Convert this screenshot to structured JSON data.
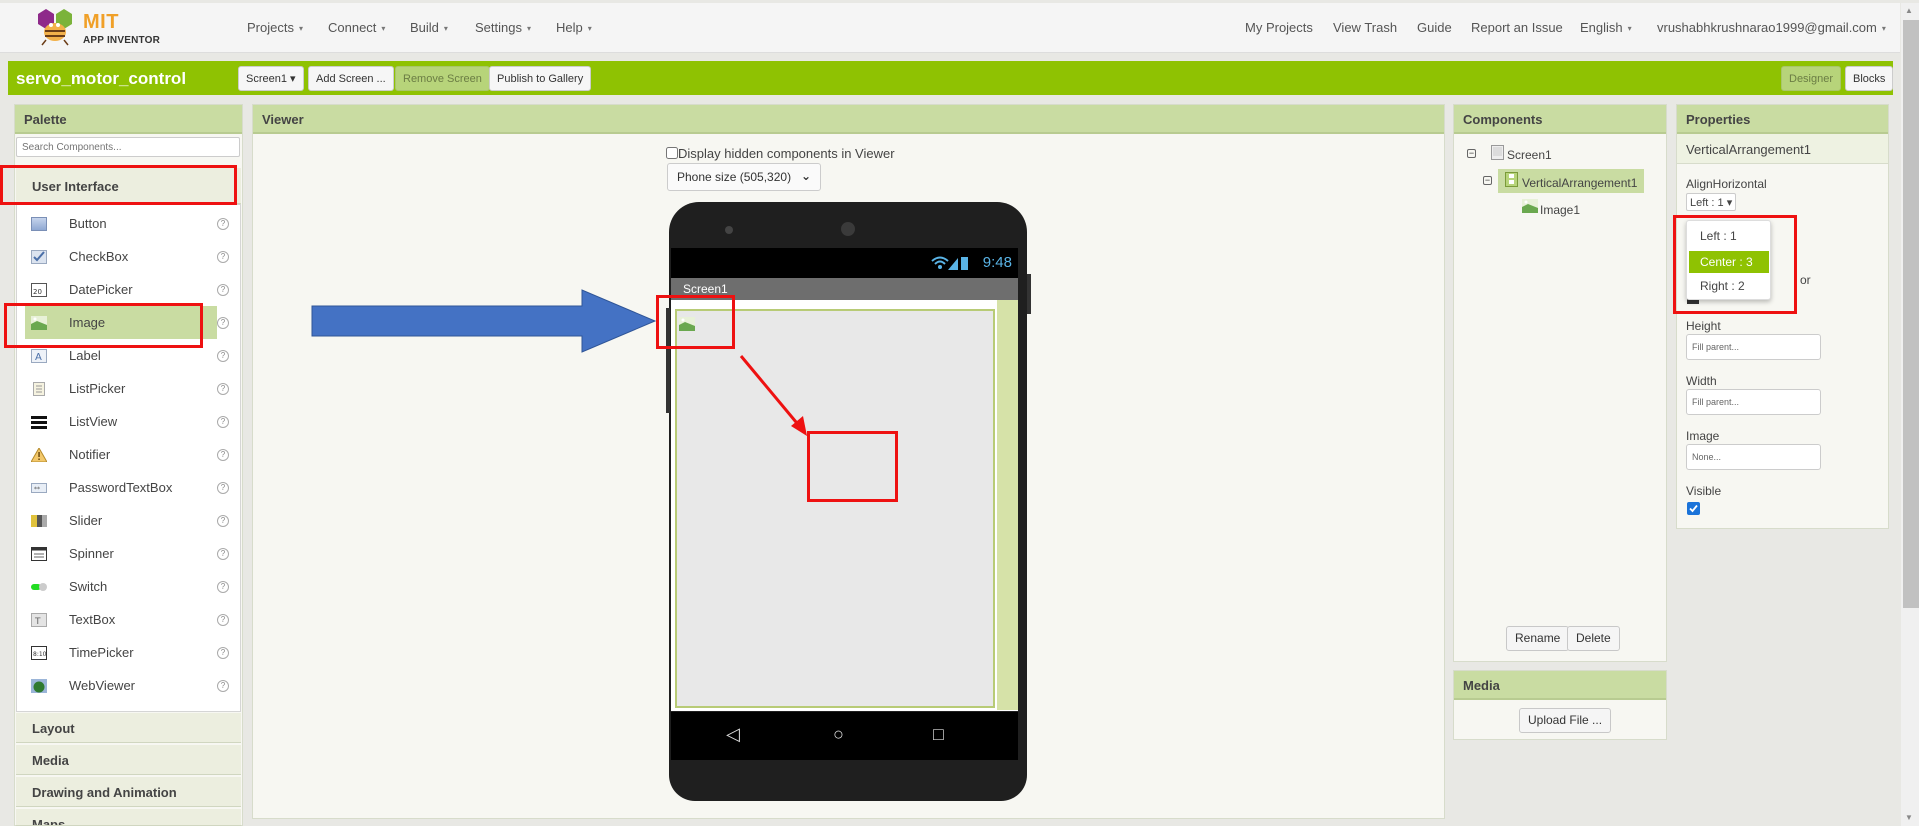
{
  "app": {
    "logo_line1": "MIT",
    "logo_line2": "APP INVENTOR"
  },
  "topnav": {
    "left_menus": [
      {
        "label": "Projects",
        "has_caret": true
      },
      {
        "label": "Connect",
        "has_caret": true
      },
      {
        "label": "Build",
        "has_caret": true
      },
      {
        "label": "Settings",
        "has_caret": true
      },
      {
        "label": "Help",
        "has_caret": true
      }
    ],
    "right_links": [
      {
        "label": "My Projects"
      },
      {
        "label": "View Trash"
      },
      {
        "label": "Guide"
      },
      {
        "label": "Report an Issue"
      },
      {
        "label": "English",
        "has_caret": true
      },
      {
        "label": "vrushabhkrushnarao1999@gmail.com",
        "has_caret": true
      }
    ],
    "caret": "▾"
  },
  "projectbar": {
    "title": "servo_motor_control",
    "screen_select": "Screen1 ▾",
    "add_screen": "Add Screen ...",
    "remove_screen": "Remove Screen",
    "publish": "Publish to Gallery",
    "designer": "Designer",
    "blocks": "Blocks"
  },
  "palette": {
    "title": "Palette",
    "search_placeholder": "Search Components...",
    "open_category": "User Interface",
    "items": [
      {
        "label": "Button",
        "icon": "button-icon"
      },
      {
        "label": "CheckBox",
        "icon": "checkbox-icon"
      },
      {
        "label": "DatePicker",
        "icon": "datepicker-icon"
      },
      {
        "label": "Image",
        "icon": "image-icon",
        "selected": true
      },
      {
        "label": "Label",
        "icon": "label-icon"
      },
      {
        "label": "ListPicker",
        "icon": "listpicker-icon"
      },
      {
        "label": "ListView",
        "icon": "listview-icon"
      },
      {
        "label": "Notifier",
        "icon": "notifier-icon"
      },
      {
        "label": "PasswordTextBox",
        "icon": "passwordtextbox-icon"
      },
      {
        "label": "Slider",
        "icon": "slider-icon"
      },
      {
        "label": "Spinner",
        "icon": "spinner-icon"
      },
      {
        "label": "Switch",
        "icon": "switch-icon"
      },
      {
        "label": "TextBox",
        "icon": "textbox-icon"
      },
      {
        "label": "TimePicker",
        "icon": "timepicker-icon"
      },
      {
        "label": "WebViewer",
        "icon": "webviewer-icon"
      }
    ],
    "help_glyph": "?",
    "categories": [
      "Layout",
      "Media",
      "Drawing and Animation",
      "Maps"
    ]
  },
  "viewer": {
    "title": "Viewer",
    "hidden_components_label": "Display hidden components in Viewer",
    "hidden_components_checked": false,
    "phone_size": "Phone size (505,320)",
    "status_time": "9:48",
    "screen_title": "Screen1"
  },
  "components": {
    "title": "Components",
    "tree": [
      {
        "label": "Screen1",
        "level": 0,
        "collapsible": true
      },
      {
        "label": "VerticalArrangement1",
        "level": 1,
        "collapsible": true,
        "selected": true
      },
      {
        "label": "Image1",
        "level": 2,
        "collapsible": false
      }
    ],
    "rename": "Rename",
    "delete": "Delete"
  },
  "media": {
    "title": "Media",
    "upload": "Upload File ..."
  },
  "properties": {
    "title": "Properties",
    "component": "VerticalArrangement1",
    "align_horizontal_label": "AlignHorizontal",
    "align_horizontal_value": "Left : 1 ▾",
    "align_options": [
      {
        "label": "Left : 1",
        "selected": false
      },
      {
        "label": "Center : 3",
        "selected": true
      },
      {
        "label": "Right : 2",
        "selected": false
      }
    ],
    "partially_hidden_text": "or",
    "height_label": "Height",
    "height_value": "Fill parent...",
    "width_label": "Width",
    "width_value": "Fill parent...",
    "image_label": "Image",
    "image_value": "None...",
    "visible_label": "Visible",
    "visible_checked": true
  },
  "colors": {
    "accent_green": "#8fc202",
    "panel_header": "#c9dca2",
    "annotation_red": "#e11111",
    "annotation_blue": "#4472c4"
  }
}
